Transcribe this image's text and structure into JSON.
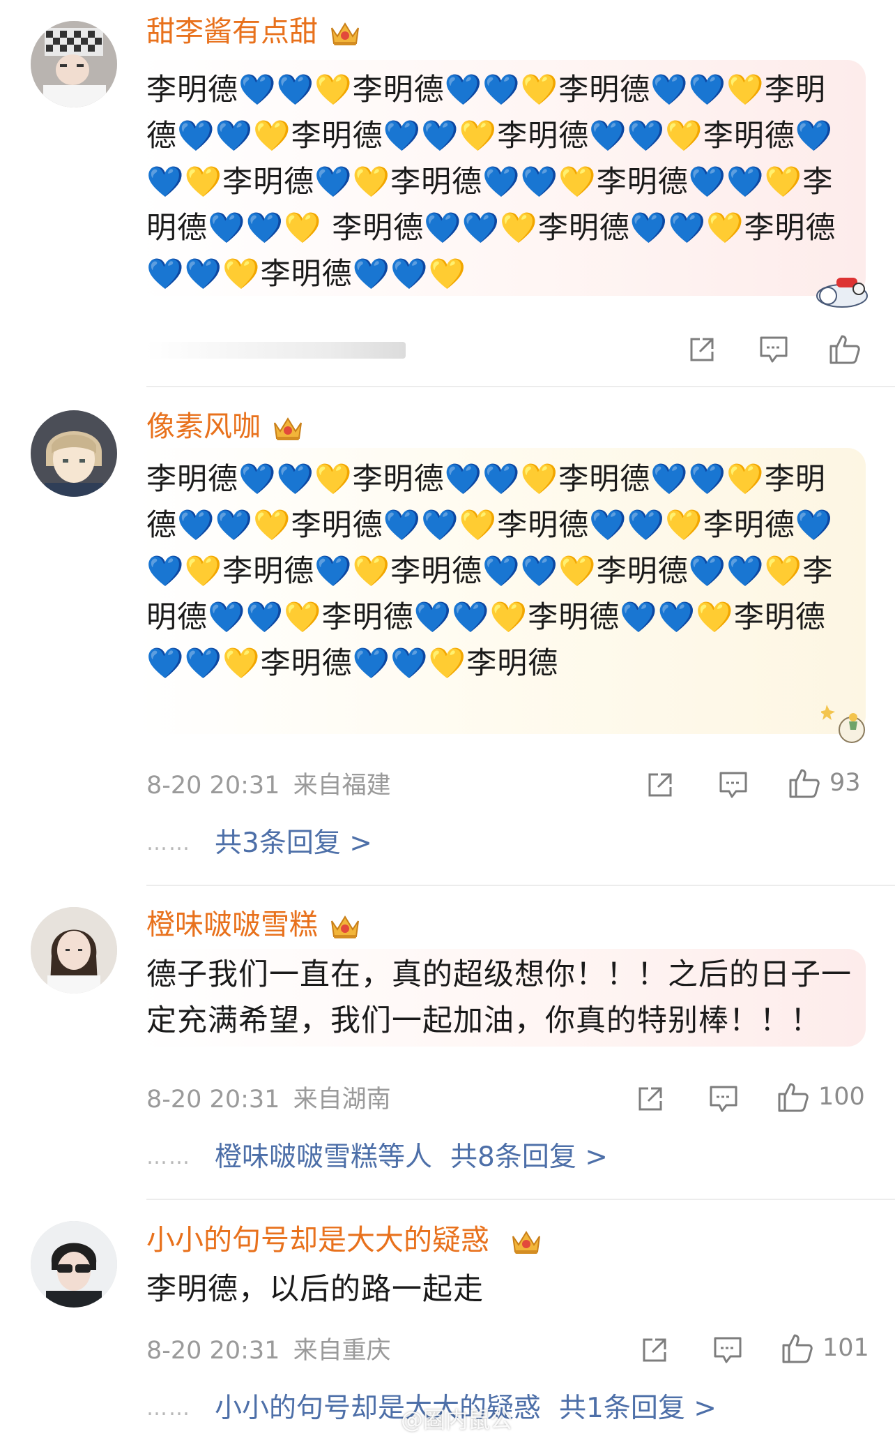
{
  "comments": [
    {
      "username": "甜李酱有点甜",
      "text": "李明德💙💙💛李明德💙💙💛李明德💙💙💛李明德💙💙💛李明德💙💙💛李明德💙💙💛李明德💙💙💛李明德💙💛李明德💙💙💛李明德💙💙💛李明德💙💙💛 李明德💙💙💛李明德💙💙💛李明德💙💙💛李明德💙💙💛",
      "crown_icon": "crown-badge-icon",
      "sticker_icon": "airplane-sticker-icon",
      "actions": [
        "share-icon",
        "comment-icon",
        "like-icon"
      ]
    },
    {
      "username": "像素风咖",
      "text": "李明德💙💙💛李明德💙💙💛李明德💙💙💛李明德💙💙💛李明德💙💙💛李明德💙💙💛李明德💙💙💛李明德💙💛李明德💙💙💛李明德💙💙💛李明德💙💙💛李明德💙💙💛李明德💙💙💛李明德💙💙💛李明德💙💙💛李明德",
      "time": "8-20 20:31",
      "location": "来自福建",
      "likes": "93",
      "reply_summary": "共3条回复 >",
      "sticker_icon": "little-prince-sticker-icon"
    },
    {
      "username": "橙味啵啵雪糕",
      "text": "德子我们一直在，真的超级想你！！！之后的日子一定充满希望，我们一起加油，你真的特别棒！！！",
      "time": "8-20 20:31",
      "location": "来自湖南",
      "likes": "100",
      "reply_by": "橙味啵啵雪糕等人",
      "reply_summary": "共8条回复 >"
    },
    {
      "username": "小小的句号却是大大的疑惑",
      "text": "李明德，以后的路一起走",
      "time": "8-20 20:31",
      "location": "来自重庆",
      "likes": "101",
      "reply_by": "小小的句号却是大大的疑惑",
      "reply_summary": "共1条回复 >"
    }
  ],
  "ellipsis": "……",
  "watermark": "@圈内鼠公",
  "colors": {
    "username": "#e8711c",
    "reply_link": "#4d6fa8",
    "meta": "#9a9a9a"
  }
}
